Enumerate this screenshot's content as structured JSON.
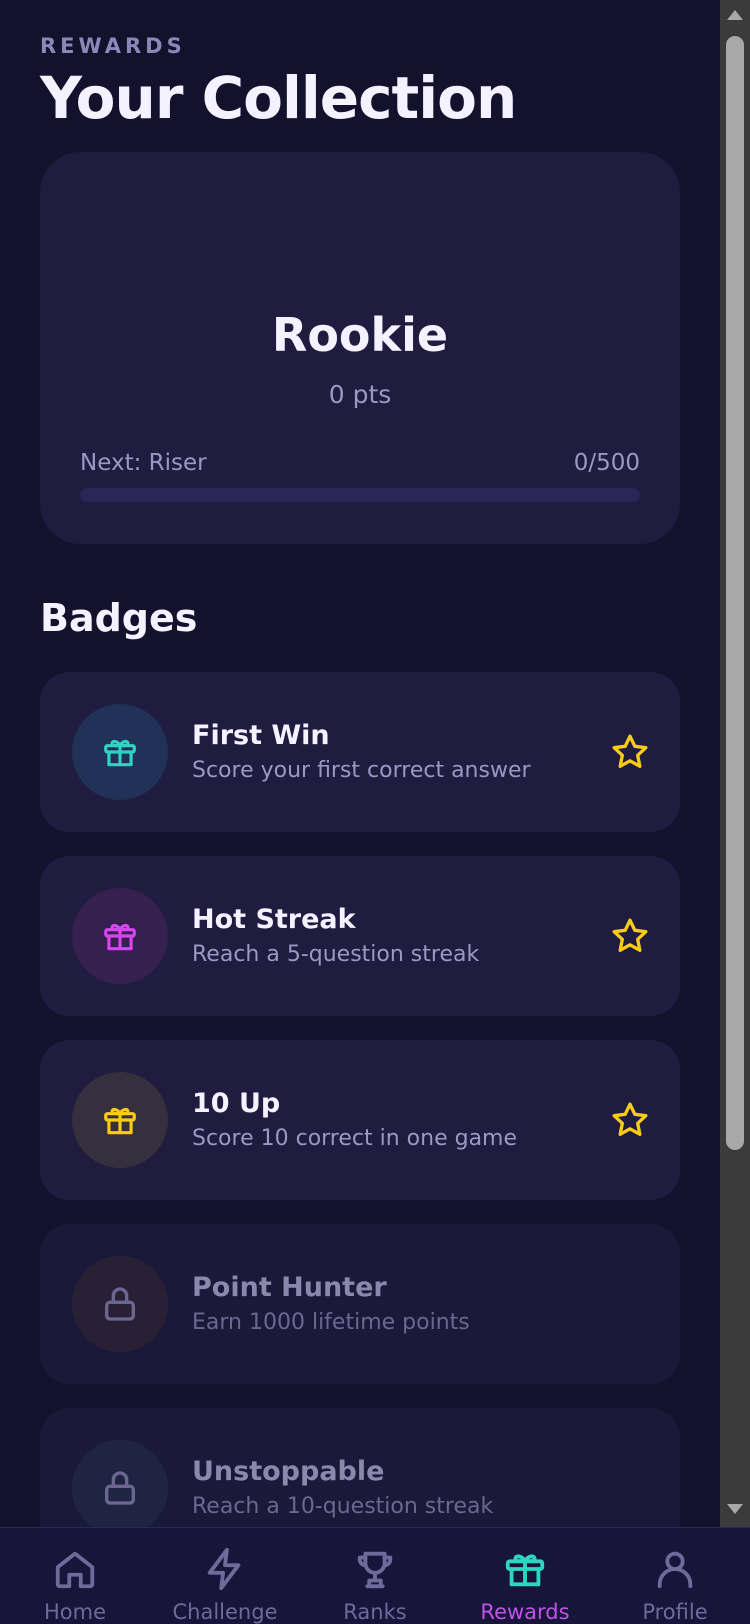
{
  "header": {
    "eyebrow": "REWARDS",
    "title": "Your Collection"
  },
  "tier": {
    "name": "Rookie",
    "points": "0 pts",
    "next_label": "Next: Riser",
    "progress_text": "0/500",
    "progress_fraction": 0
  },
  "badges_section": {
    "title": "Badges",
    "items": [
      {
        "title": "First Win",
        "desc": "Score your first correct answer",
        "icon": "gift-icon",
        "color": "#2fd5c3",
        "state": "unlocked"
      },
      {
        "title": "Hot Streak",
        "desc": "Reach a 5-question streak",
        "icon": "gift-icon",
        "color": "#d946ef",
        "state": "unlocked"
      },
      {
        "title": "10 Up",
        "desc": "Score 10 correct in one game",
        "icon": "gift-icon",
        "color": "#facc15",
        "state": "unlocked"
      },
      {
        "title": "Point Hunter",
        "desc": "Earn 1000 lifetime points",
        "icon": "lock-icon",
        "color": "#6c6791",
        "state": "locked"
      },
      {
        "title": "Unstoppable",
        "desc": "Reach a 10-question streak",
        "icon": "lock-icon",
        "color": "#6c6791",
        "state": "locked"
      }
    ]
  },
  "colors": {
    "background": "#13112b",
    "card": "#1f1c40",
    "star": "#facc15",
    "active_tab": "#c052e8",
    "active_tab_icon": "#2fd5c3"
  },
  "tabbar": {
    "tabs": [
      {
        "label": "Home",
        "icon": "home-icon",
        "active": false
      },
      {
        "label": "Challenge",
        "icon": "lightning-icon",
        "active": false
      },
      {
        "label": "Ranks",
        "icon": "trophy-icon",
        "active": false
      },
      {
        "label": "Rewards",
        "icon": "gift-icon",
        "active": true
      },
      {
        "label": "Profile",
        "icon": "user-icon",
        "active": false
      }
    ]
  }
}
